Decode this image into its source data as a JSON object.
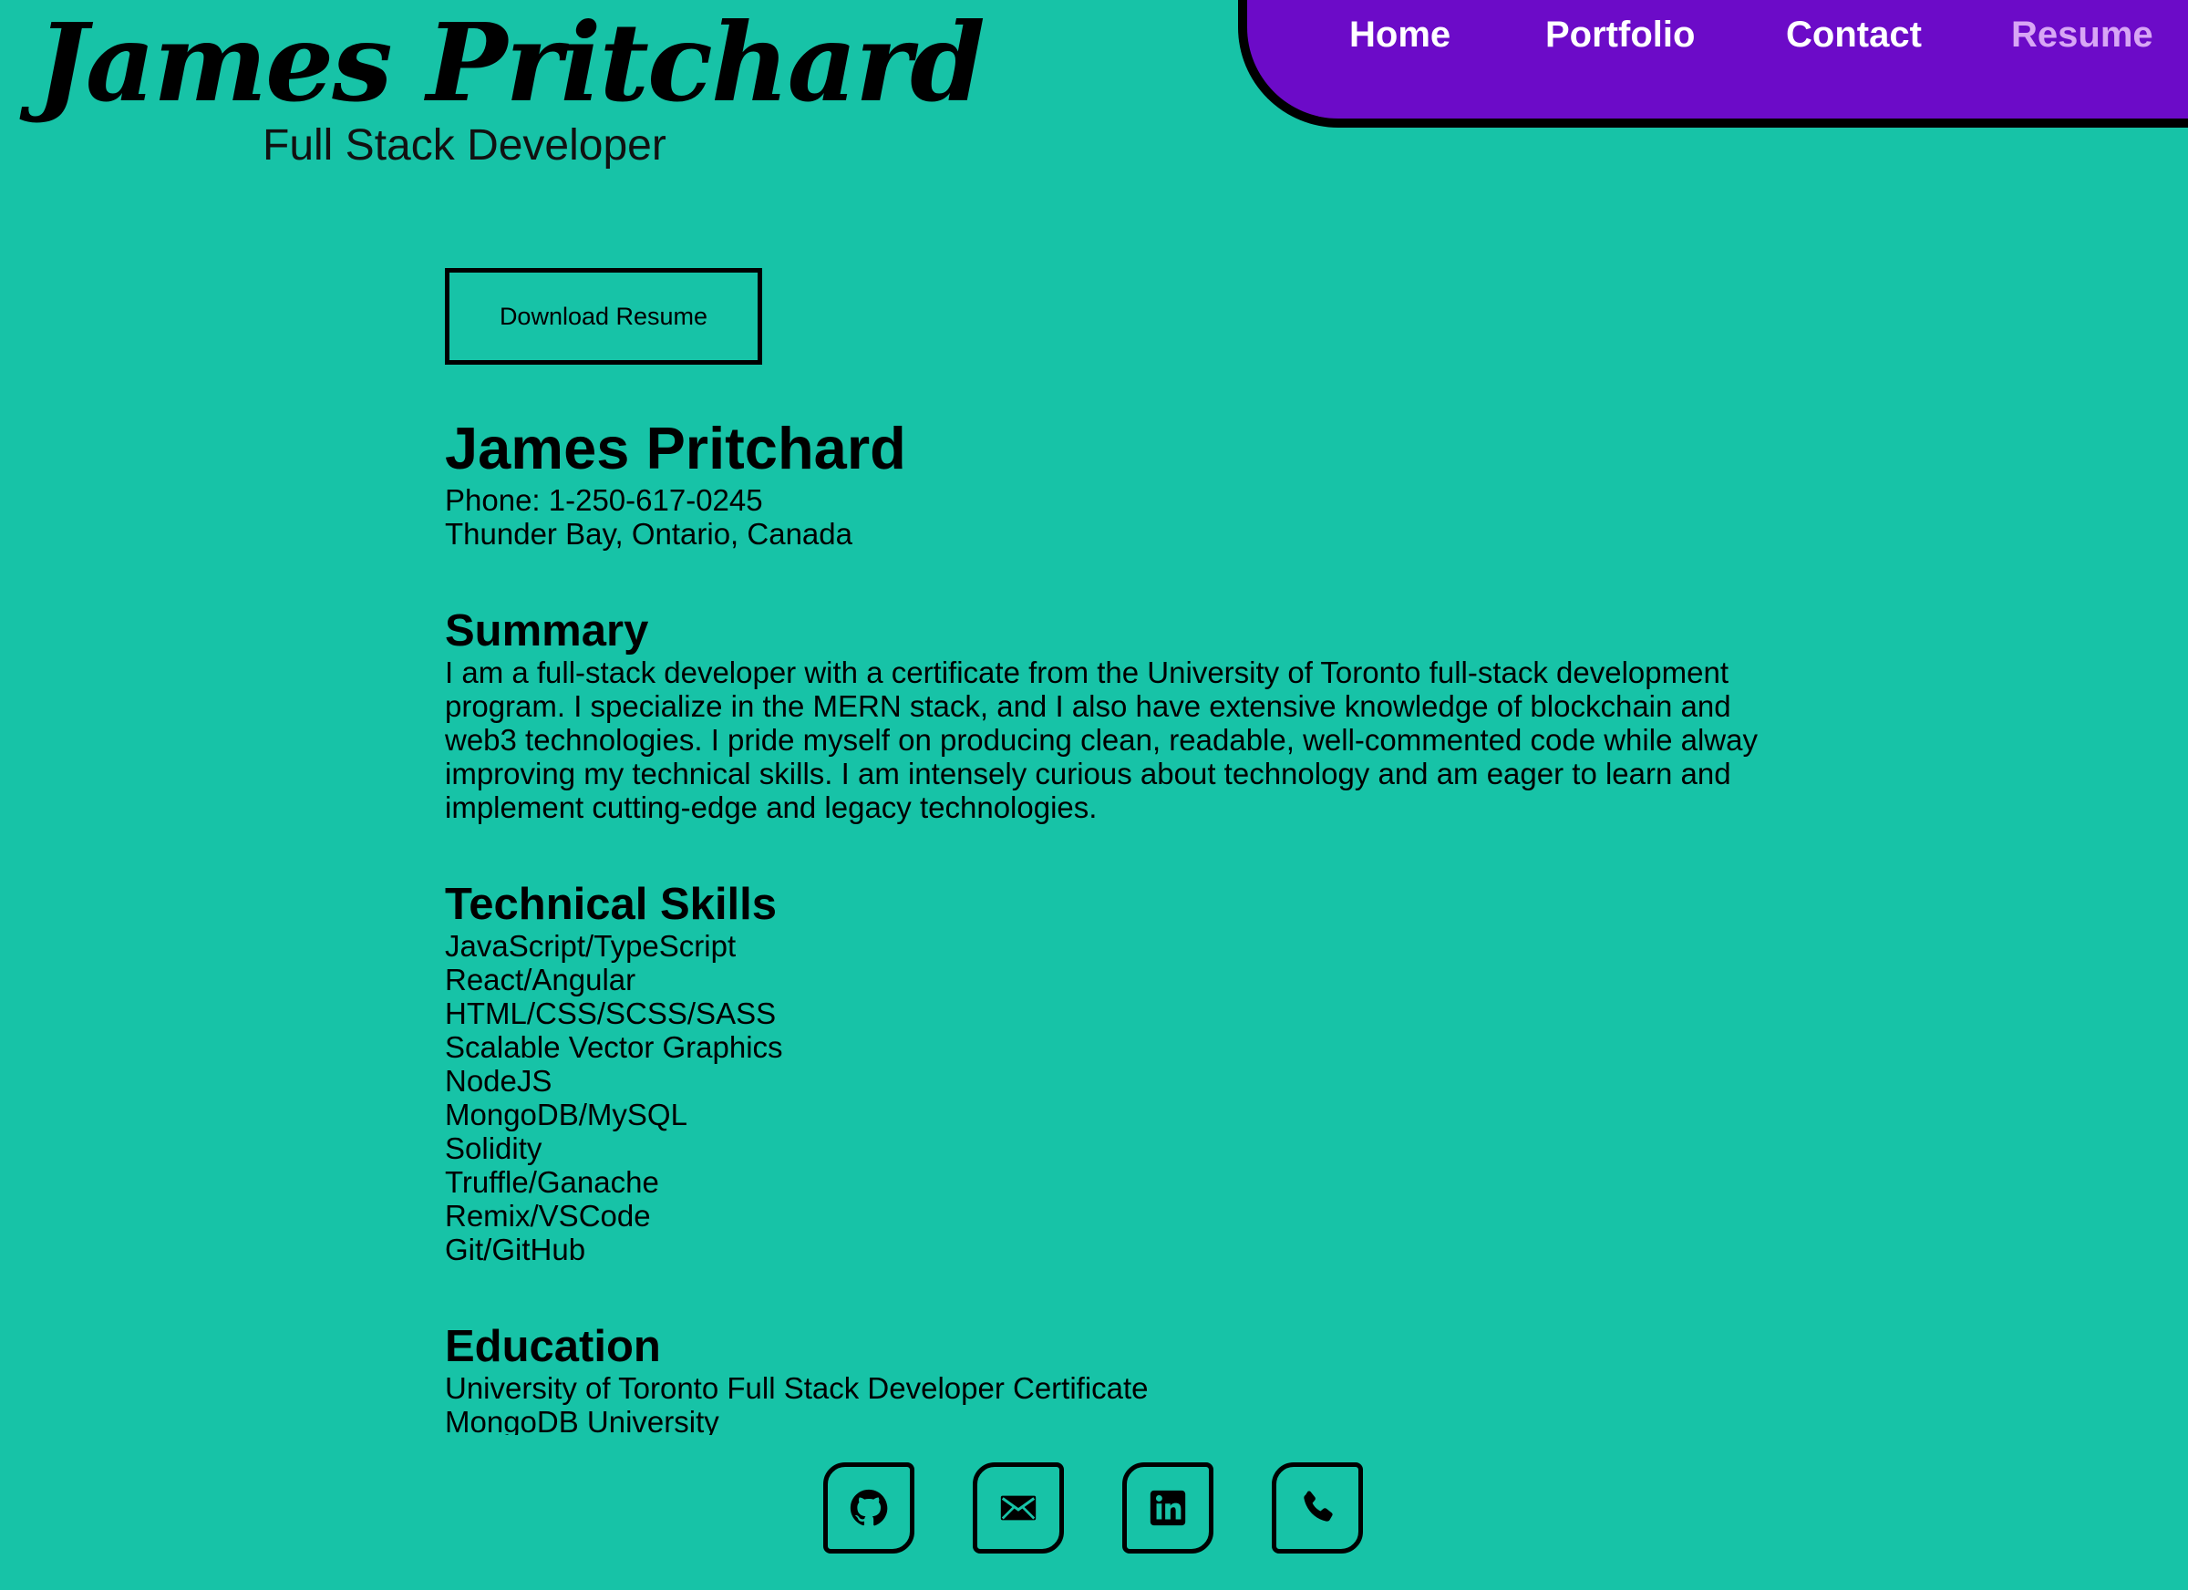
{
  "header": {
    "brand_name": "James Pritchard",
    "brand_subtitle": "Full Stack Developer",
    "nav": [
      {
        "label": "Home",
        "active": false
      },
      {
        "label": "Portfolio",
        "active": false
      },
      {
        "label": "Contact",
        "active": false
      },
      {
        "label": "Resume",
        "active": true
      }
    ]
  },
  "resume": {
    "download_label": "Download Resume",
    "name": "James Pritchard",
    "phone": "Phone: 1-250-617-0245",
    "location": "Thunder Bay, Ontario, Canada",
    "summary": {
      "heading": "Summary",
      "lines": [
        "I am a full-stack developer with a certificate from the University of Toronto full-stack development",
        "program. I specialize in the MERN stack, and I also have extensive knowledge of blockchain and",
        "web3 technologies. I pride myself on producing clean, readable, well-commented code while always",
        "improving my technical skills. I am intensely curious about technology and am eager to learn and",
        "implement cutting-edge and legacy technologies."
      ]
    },
    "skills": {
      "heading": "Technical Skills",
      "items": [
        "JavaScript/TypeScript",
        "React/Angular",
        "HTML/CSS/SCSS/SASS",
        "Scalable Vector Graphics",
        "NodeJS",
        "MongoDB/MySQL",
        "Solidity",
        "Truffle/Ganache",
        "Remix/VSCode",
        "Git/GitHub"
      ]
    },
    "education": {
      "heading": "Education",
      "items": [
        "University of Toronto Full Stack Developer Certificate",
        "MongoDB University"
      ]
    }
  },
  "socials": [
    {
      "icon": "github-icon"
    },
    {
      "icon": "mail-icon"
    },
    {
      "icon": "linkedin-icon"
    },
    {
      "icon": "phone-icon"
    }
  ],
  "colors": {
    "background": "#17c3a7",
    "nav_background": "#6c0bc8",
    "nav_link": "#ffffff",
    "nav_link_active": "#d8a6f5",
    "text": "#000000"
  }
}
